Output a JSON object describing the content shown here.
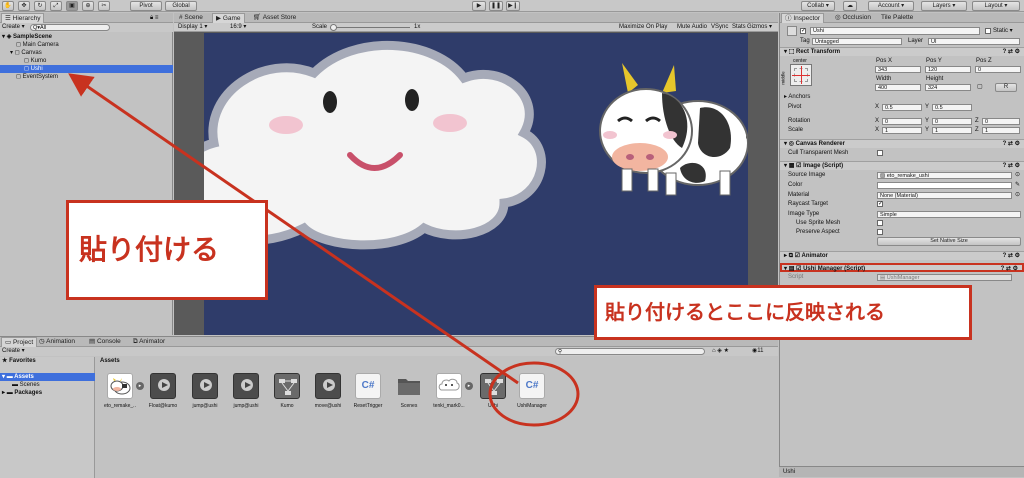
{
  "toolbar": {
    "pivot": "Pivot",
    "global": "Global",
    "collab": "Collab ▾",
    "account": "Account ▾",
    "layers": "Layers ▾",
    "layout": "Layout ▾"
  },
  "hierarchy": {
    "tab": "Hierarchy",
    "create": "Create ▾",
    "search_placeholder": "Q▾All",
    "items": [
      "SampleScene",
      "Main Camera",
      "Canvas",
      "Kumo",
      "Ushi",
      "EventSystem"
    ]
  },
  "scene_tabs": [
    "Scene",
    "Game",
    "Asset Store"
  ],
  "game_bar": {
    "display": "Display 1",
    "aspect": "16:9",
    "scale_label": "Scale",
    "scale_value": "1x",
    "options": [
      "Maximize On Play",
      "Mute Audio",
      "VSync",
      "Stats",
      "Gizmos ▾"
    ]
  },
  "inspector": {
    "tabs": [
      "Inspector",
      "Occlusion",
      "Tile Palette"
    ],
    "object_name": "Ushi",
    "static_label": "Static ▾",
    "tag_label": "Tag",
    "tag_value": "Untagged",
    "layer_label": "Layer",
    "layer_value": "UI",
    "rect_transform": {
      "title": "Rect Transform",
      "anchor_preset": "center",
      "side_label": "middle",
      "pos_x_label": "Pos X",
      "pos_x": "343",
      "pos_y_label": "Pos Y",
      "pos_y": "120",
      "pos_z_label": "Pos Z",
      "pos_z": "0",
      "width_label": "Width",
      "width": "400",
      "height_label": "Height",
      "height": "324",
      "r_button": "R",
      "anchors": "Anchors",
      "pivot_label": "Pivot",
      "pivot_x": "0.5",
      "pivot_y": "0.5",
      "rotation_label": "Rotation",
      "rot_x": "0",
      "rot_y": "0",
      "rot_z": "0",
      "scale_label": "Scale",
      "scale_x": "1",
      "scale_y": "1",
      "scale_z": "1",
      "x": "X",
      "y": "Y",
      "z": "Z"
    },
    "canvas_renderer": {
      "title": "Canvas Renderer",
      "cull": "Cull Transparent Mesh"
    },
    "image": {
      "title": "Image (Script)",
      "source_label": "Source Image",
      "source_value": "eto_remake_ushi",
      "color_label": "Color",
      "material_label": "Material",
      "material_value": "None (Material)",
      "raycast_label": "Raycast Target",
      "image_type_label": "Image Type",
      "image_type_value": "Simple",
      "use_sprite_mesh": "Use Sprite Mesh",
      "preserve_aspect": "Preserve Aspect",
      "native_size_button": "Set Native Size"
    },
    "animator": {
      "title": "Animator"
    },
    "ushi_manager": {
      "title": "Ushi Manager (Script)",
      "script_label": "Script",
      "script_value": "UshiManager"
    },
    "footer_name": "Ushi"
  },
  "project": {
    "tabs": [
      "Project",
      "Animation",
      "Console",
      "Animator"
    ],
    "create": "Create ▾",
    "favorites": "Favorites",
    "tree": [
      "Assets",
      "Scenes",
      "Packages"
    ],
    "breadcrumb": "Assets",
    "count": "11",
    "assets": [
      {
        "name": "eto_remake_...",
        "kind": "cow"
      },
      {
        "name": "Float@kumo",
        "kind": "anim"
      },
      {
        "name": "jump@ushi",
        "kind": "anim"
      },
      {
        "name": "jump@ushi",
        "kind": "anim"
      },
      {
        "name": "Kumo",
        "kind": "controller"
      },
      {
        "name": "move@ushi",
        "kind": "anim"
      },
      {
        "name": "ResetTrigger",
        "kind": "script"
      },
      {
        "name": "Scenes",
        "kind": "folder"
      },
      {
        "name": "tenki_mark0...",
        "kind": "cloud"
      },
      {
        "name": "Ushi",
        "kind": "controller"
      },
      {
        "name": "UshiManager",
        "kind": "script"
      }
    ],
    "script_glyph": "C#"
  },
  "annotations": {
    "paste": "貼り付ける",
    "reflected": "貼り付けるとここに反映される"
  },
  "colors": {
    "accent_red": "#c8321f",
    "selection_blue": "#3e6fdc",
    "game_bg": "#2f3c6a"
  }
}
